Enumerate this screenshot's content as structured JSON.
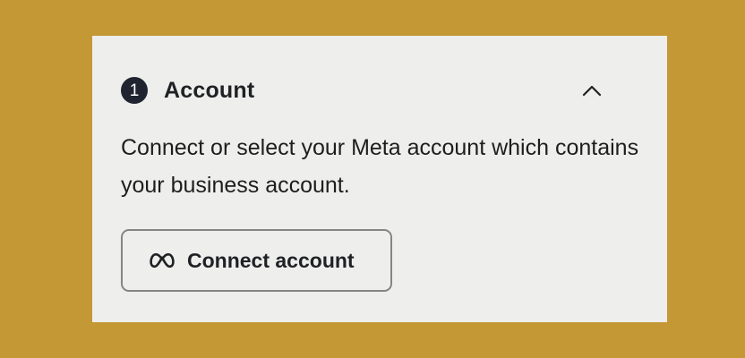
{
  "account_section": {
    "step_number": "1",
    "title": "Account",
    "description": "Connect or select your Meta account which contains your business account.",
    "connect_button_label": "Connect account",
    "collapse_icon": "chevron-up-icon",
    "connect_icon": "meta-logo-icon",
    "colors": {
      "page_background": "#c49834",
      "card_background": "#eeeeed",
      "badge_background": "#1f2430",
      "text_primary": "#1f2124",
      "button_border": "#858585"
    }
  }
}
